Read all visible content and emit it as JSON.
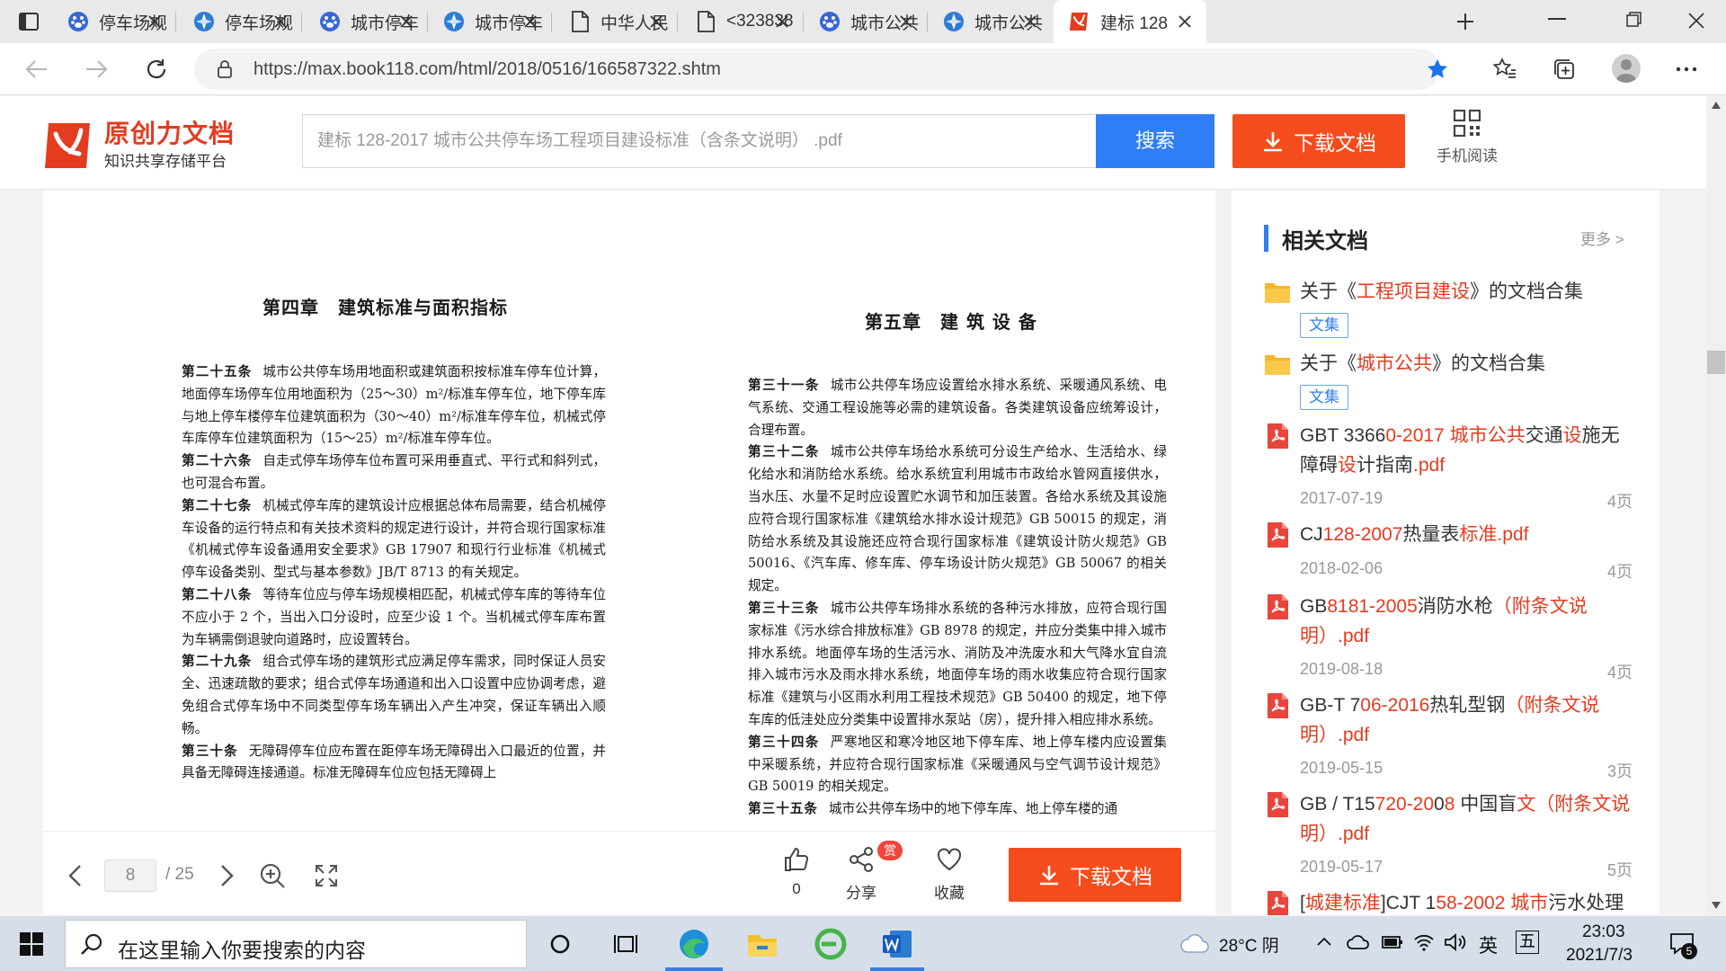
{
  "browser": {
    "tabs": [
      {
        "label": "停车场规",
        "icon": "paw-icon"
      },
      {
        "label": "停车场规",
        "icon": "compass-icon"
      },
      {
        "label": "城市停车",
        "icon": "paw-icon"
      },
      {
        "label": "城市停车",
        "icon": "compass-icon"
      },
      {
        "label": "中华人民",
        "icon": "page-icon"
      },
      {
        "label": "<323838",
        "icon": "page-icon"
      },
      {
        "label": "城市公共",
        "icon": "paw-icon"
      },
      {
        "label": "城市公共",
        "icon": "compass-icon"
      },
      {
        "label": "建标 128",
        "icon": "book118-icon"
      }
    ],
    "url": "https://max.book118.com/html/2018/0516/166587322.shtm"
  },
  "site": {
    "logo_title": "原创力文档",
    "logo_subtitle": "知识共享存储平台",
    "search_placeholder": "建标 128-2017 城市公共停车场工程项目建设标准（含条文说明） .pdf",
    "search_button": "搜索",
    "download_button": "下载文档",
    "mobile_read": "手机阅读"
  },
  "document": {
    "left_title": "第四章　建筑标准与面积指标",
    "right_title": "第五章　建 筑 设 备",
    "left_paragraphs": [
      {
        "head": "第二十五条",
        "body": "城市公共停车场用地面积或建筑面积按标准车停车位计算，地面停车场停车位用地面积为（25～30）m²/标准车停车位，地下停车库与地上停车楼停车位建筑面积为（30～40）m²/标准车停车位，机械式停车库停车位建筑面积为（15～25）m²/标准车停车位。"
      },
      {
        "head": "第二十六条",
        "body": "自走式停车场停车位布置可采用垂直式、平行式和斜列式，也可混合布置。"
      },
      {
        "head": "第二十七条",
        "body": "机械式停车库的建筑设计应根据总体布局需要，结合机械停车设备的运行特点和有关技术资料的规定进行设计，并符合现行国家标准《机械式停车设备通用安全要求》GB 17907 和现行行业标准《机械式停车设备类别、型式与基本参数》JB/T 8713 的有关规定。"
      },
      {
        "head": "第二十八条",
        "body": "等待车位应与停车场规模相匹配，机械式停车库的等待车位不应小于 2 个，当出入口分设时，应至少设 1 个。当机械式停车库布置为车辆需倒退驶向道路时，应设置转台。"
      },
      {
        "head": "第二十九条",
        "body": "组合式停车场的建筑形式应满足停车需求，同时保证人员安全、迅速疏散的要求；组合式停车场通道和出入口设置中应协调考虑，避免组合式停车场中不同类型停车场车辆出入产生冲突，保证车辆出入顺畅。"
      },
      {
        "head": "第三十条",
        "body": "无障碍停车位应布置在距停车场无障碍出入口最近的位置，并具备无障碍连接通道。标准无障碍车位应包括无障碍上"
      }
    ],
    "right_paragraphs": [
      {
        "head": "第三十一条",
        "body": "城市公共停车场应设置给水排水系统、采暖通风系统、电气系统、交通工程设施等必需的建筑设备。各类建筑设备应统筹设计，合理布置。"
      },
      {
        "head": "第三十二条",
        "body": "城市公共停车场给水系统可分设生产给水、生活给水、绿化给水和消防给水系统。给水系统宜利用城市市政给水管网直接供水，当水压、水量不足时应设置贮水调节和加压装置。各给水系统及其设施应符合现行国家标准《建筑给水排水设计规范》GB 50015 的规定，消防给水系统及其设施还应符合现行国家标准《建筑设计防火规范》GB 50016、《汽车库、修车库、停车场设计防火规范》GB 50067 的相关规定。"
      },
      {
        "head": "第三十三条",
        "body": "城市公共停车场排水系统的各种污水排放，应符合现行国家标准《污水综合排放标准》GB 8978 的规定，并应分类集中排入城市排水系统。地面停车场的生活污水、消防及冲洗废水和大气降水宜自流排入城市污水及雨水排水系统，地面停车场的雨水收集应符合现行国家标准《建筑与小区雨水利用工程技术规范》GB 50400 的规定，地下停车库的低洼处应分类集中设置排水泵站（房），提升排入相应排水系统。"
      },
      {
        "head": "第三十四条",
        "body": "严寒地区和寒冷地区地下停车库、地上停车楼内应设置集中采暖系统，并应符合现行国家标准《采暖通风与空气调节设计规范》GB 50019 的相关规定。"
      },
      {
        "head": "第三十五条",
        "body": "城市公共停车场中的地下停车库、地上停车楼的通"
      }
    ]
  },
  "viewer_toolbar": {
    "page_current": "8",
    "page_total": "/ 25",
    "like_count": "0",
    "share_label": "分享",
    "reward_badge": "赏",
    "favorite_label": "收藏",
    "download_button": "下载文档"
  },
  "sidebar": {
    "title": "相关文档",
    "more": "更多 >",
    "items": [
      {
        "type": "folder",
        "title_html": "关于《<span class=\"hl\">工程项目建设</span>》的文档合集",
        "tag": "文集"
      },
      {
        "type": "folder",
        "title_html": "关于《<span class=\"hl\">城市公共</span>》的文档合集",
        "tag": "文集"
      },
      {
        "type": "pdf",
        "title_html": "GBT 3366<span class=\"hl\">0-2017 城市公共</span>交通<span class=\"hl\">设</span>施无障碍<span class=\"hl\">设</span>计指南<span class=\"hl\">.pdf</span>",
        "date": "2017-07-19",
        "pages": "4页"
      },
      {
        "type": "pdf",
        "title_html": "CJ<span class=\"hl\">128-2007</span>热量表<span class=\"hl\">标准.pdf</span>",
        "date": "2018-02-06",
        "pages": "4页"
      },
      {
        "type": "pdf",
        "title_html": "GB<span class=\"hl\">8181-2005</span>消防水枪<span class=\"hl\">（附条文说明）.pdf</span>",
        "date": "2019-08-18",
        "pages": "4页"
      },
      {
        "type": "pdf",
        "title_html": "GB-T 7<span class=\"hl\">06-2016</span>热轧型钢<span class=\"hl\">（附条文说明）.pdf</span>",
        "date": "2019-05-15",
        "pages": "3页"
      },
      {
        "type": "pdf",
        "title_html": "GB / T15<span class=\"hl\">720-20</span>0<span class=\"hl\">8</span> 中国盲<span class=\"hl\">文（附条文说明）.pdf</span>",
        "date": "2019-05-17",
        "pages": "5页"
      },
      {
        "type": "pdf",
        "title_html": "[<span class=\"hl\">城建标准</span>]CJT 1<span class=\"hl\">58-2002 城市</span>污水处理",
        "date": "",
        "pages": ""
      }
    ]
  },
  "taskbar": {
    "search_placeholder": "在这里输入你要搜索的内容",
    "weather": "28°C 阴",
    "ime_lang": "英",
    "ime_mode": "五",
    "time": "23:03",
    "date": "2021/7/3",
    "notification_count": "5"
  }
}
